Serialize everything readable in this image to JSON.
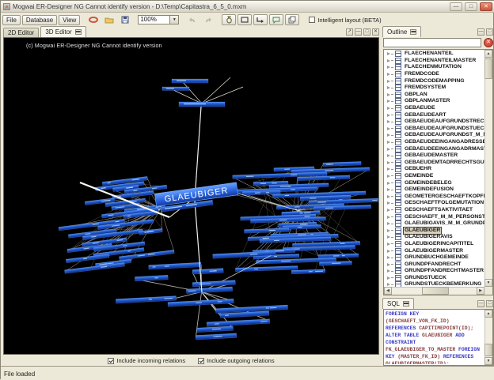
{
  "window": {
    "title": "Mogwai ER-Designer NG Cannot identify version  - D:\\Temp\\Capitastra_6_5_0.mxm"
  },
  "menubar": {
    "items": [
      "File",
      "Database",
      "View"
    ]
  },
  "toolbar": {
    "zoom_value": "100%",
    "intelligent_layout": {
      "label": "Intelligent layout (BETA)",
      "checked": false
    }
  },
  "editor_tabs": {
    "tab_2d": "2D Editor",
    "tab_3d": "3D Editor"
  },
  "canvas": {
    "copyright": "(c) Mogwai ER-Designer NG Cannot identify version",
    "main_node": "GLAEUBIGER"
  },
  "relation_options": {
    "incoming": {
      "label": "Include incoming relations",
      "checked": true
    },
    "outgoing": {
      "label": "Include outgoing relations",
      "checked": true
    }
  },
  "outline": {
    "title": "Outline",
    "search_value": "",
    "selected": "GLAEUBIGER",
    "items": [
      "FLAECHENANTEIL",
      "FLAECHENANTEILMASTER",
      "FLAECHENMUTATION",
      "FREMDCODE",
      "FREMDCODEMAPPING",
      "FREMDSYSTEM",
      "GBPLAN",
      "GBPLANMASTER",
      "GEBAEUDE",
      "GEBAEUDEART",
      "GEBAEUDEAUFGRUNDSTRECHTSG",
      "GEBAEUDEAUFGRUNDSTUECK",
      "GEBAEUDEAUFGRUNDST_M_M_S",
      "GEBAEUDEEINGANGADRESSE",
      "GEBAEUDEEINGANGADRMASTER",
      "GEBAEUDEMASTER",
      "GEBAEUDEMTADRRECHTSGUELT",
      "GEBUEHR",
      "GEMEINDE",
      "GEMEINDEBELEG",
      "GEMEINDEFUSION",
      "GEOMETERGESCHAEFTKOPFDATE",
      "GESCHAEFTFOLGEMUTATION",
      "GESCHAEFTSAKTIVITAET",
      "GESCHAEFT_M_M_PERSONSTAM",
      "GLAEUBIGAVIS_M_M_GRUNDPFR",
      "GLAEUBIGER",
      "GLAEUBIGERAVIS",
      "GLAEUBIGERINCAPITITEL",
      "GLAEUBIGERMASTER",
      "GRUNDBUCHGEMEINDE",
      "GRUNDPFANDRECHT",
      "GRUNDPFANDRECHTMASTER",
      "GRUNDSTUECK",
      "GRUNDSTUECKBEMERKUNG"
    ]
  },
  "sql_panel": {
    "title": "SQL",
    "lines": [
      [
        {
          "t": "FOREIGN KEY",
          "c": "kw"
        },
        {
          "t": " (GESCHAEFT_VON_FK_ID)",
          "c": "id"
        }
      ],
      [
        {
          "t": "REFERENCES",
          "c": "kw"
        },
        {
          "t": " CAPITIMEPOINT(ID);",
          "c": "id"
        }
      ],
      [
        {
          "t": "ALTER TABLE",
          "c": "kw"
        },
        {
          "t": " GLAEUBIGER",
          "c": "id"
        },
        {
          "t": " ADD",
          "c": "kw"
        }
      ],
      [
        {
          "t": "CONSTRAINT",
          "c": "kw"
        }
      ],
      [
        {
          "t": "FK_GLAEUBIGER_TO_MASTER",
          "c": "id"
        },
        {
          "t": " FOREIGN",
          "c": "kw"
        }
      ],
      [
        {
          "t": "KEY",
          "c": "kw"
        },
        {
          "t": " (MASTER_FK_ID)",
          "c": "id"
        },
        {
          "t": " REFERENCES",
          "c": "kw"
        }
      ],
      [
        {
          "t": "GLAEUBIGERMASTER(ID);",
          "c": "id"
        }
      ]
    ]
  },
  "statusbar": {
    "text": "File loaded"
  },
  "colors": {
    "entity_blue": "#2a65e0",
    "keyword_blue": "#3a3ac8",
    "identifier_red": "#8a4040",
    "close_button": "#cd5740",
    "canvas_bg": "#000000"
  }
}
